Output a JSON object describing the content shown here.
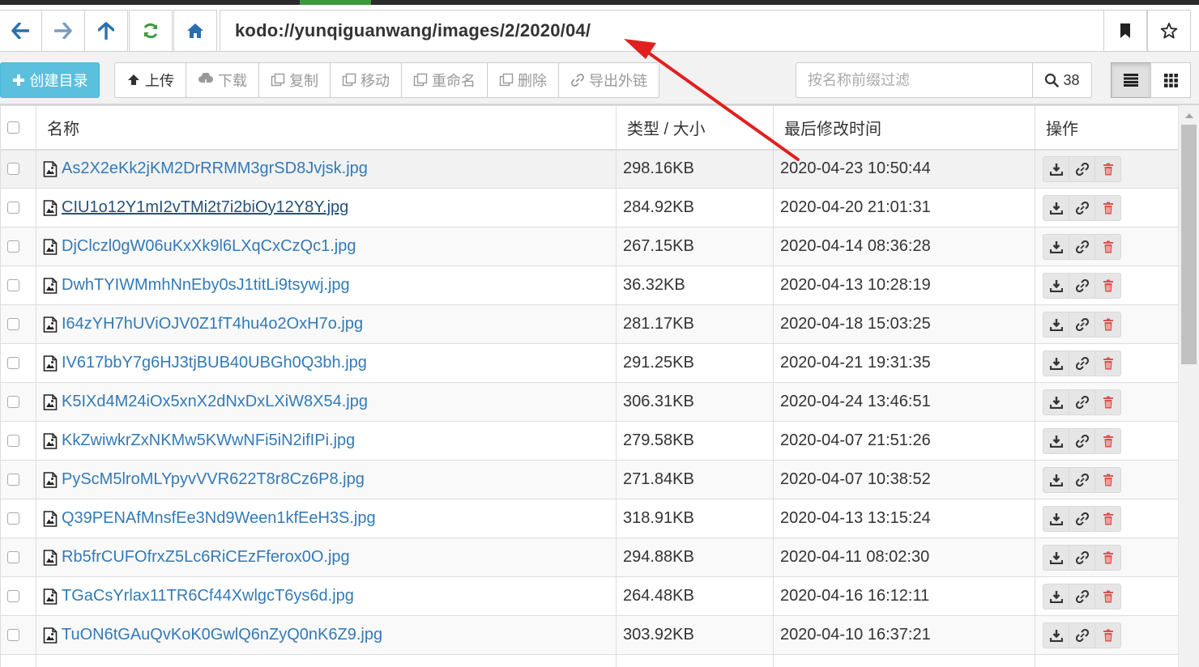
{
  "address": {
    "path": "kodo://yunqiguanwang/images/2/2020/04/",
    "back_icon": "arrow-left-icon",
    "forward_icon": "arrow-right-icon",
    "up_icon": "arrow-up-icon",
    "refresh_icon": "refresh-icon",
    "home_icon": "home-icon",
    "bookmark_icon": "bookmark-icon",
    "star_icon": "star-icon"
  },
  "toolbar": {
    "create_dir_label": "创建目录",
    "upload_label": "上传",
    "download_label": "下载",
    "copy_label": "复制",
    "move_label": "移动",
    "rename_label": "重命名",
    "delete_label": "删除",
    "export_link_label": "导出外链",
    "filter_placeholder": "按名称前缀过滤",
    "count": "38"
  },
  "table": {
    "headers": {
      "name": "名称",
      "type_size": "类型 / 大小",
      "modified": "最后修改时间",
      "actions": "操作"
    },
    "rows": [
      {
        "name": "As2X2eKk2jKM2DrRRMM3grSD8Jvjsk.jpg",
        "size": "298.16KB",
        "modified": "2020-04-23 10:50:44"
      },
      {
        "name": "CIU1o12Y1mI2vTMi2t7i2biOy12Y8Y.jpg",
        "size": "284.92KB",
        "modified": "2020-04-20 21:01:31"
      },
      {
        "name": "DjClczl0gW06uKxXk9l6LXqCxCzQc1.jpg",
        "size": "267.15KB",
        "modified": "2020-04-14 08:36:28"
      },
      {
        "name": "DwhTYIWMmhNnEby0sJ1titLi9tsywj.jpg",
        "size": "36.32KB",
        "modified": "2020-04-13 10:28:19"
      },
      {
        "name": "I64zYH7hUViOJV0Z1fT4hu4o2OxH7o.jpg",
        "size": "281.17KB",
        "modified": "2020-04-18 15:03:25"
      },
      {
        "name": "IV617bbY7g6HJ3tjBUB40UBGh0Q3bh.jpg",
        "size": "291.25KB",
        "modified": "2020-04-21 19:31:35"
      },
      {
        "name": "K5IXd4M24iOx5xnX2dNxDxLXiW8X54.jpg",
        "size": "306.31KB",
        "modified": "2020-04-24 13:46:51"
      },
      {
        "name": "KkZwiwkrZxNKMw5KWwNFi5iN2ifIPi.jpg",
        "size": "279.58KB",
        "modified": "2020-04-07 21:51:26"
      },
      {
        "name": "PyScM5lroMLYpyvVVR622T8r8Cz6P8.jpg",
        "size": "271.84KB",
        "modified": "2020-04-07 10:38:52"
      },
      {
        "name": "Q39PENAfMnsfEe3Nd9Ween1kfEeH3S.jpg",
        "size": "318.91KB",
        "modified": "2020-04-13 13:15:24"
      },
      {
        "name": "Rb5frCUFOfrxZ5Lc6RiCEzFferox0O.jpg",
        "size": "294.88KB",
        "modified": "2020-04-11 08:02:30"
      },
      {
        "name": "TGaCsYrlax11TR6Cf44XwlgcT6ys6d.jpg",
        "size": "264.48KB",
        "modified": "2020-04-16 16:12:11"
      },
      {
        "name": "TuON6tGAuQvKoK0GwlQ6nZyQ0nK6Z9.jpg",
        "size": "303.92KB",
        "modified": "2020-04-10 16:37:21"
      },
      {
        "name": "",
        "size": "",
        "modified": ""
      }
    ]
  },
  "colors": {
    "primary": "#5bc0de",
    "link": "#337ab7",
    "danger": "#d9534f",
    "refresh_green": "#3c9a3c",
    "nav_blue": "#2a6fb0",
    "annotation_red": "#e02020"
  }
}
